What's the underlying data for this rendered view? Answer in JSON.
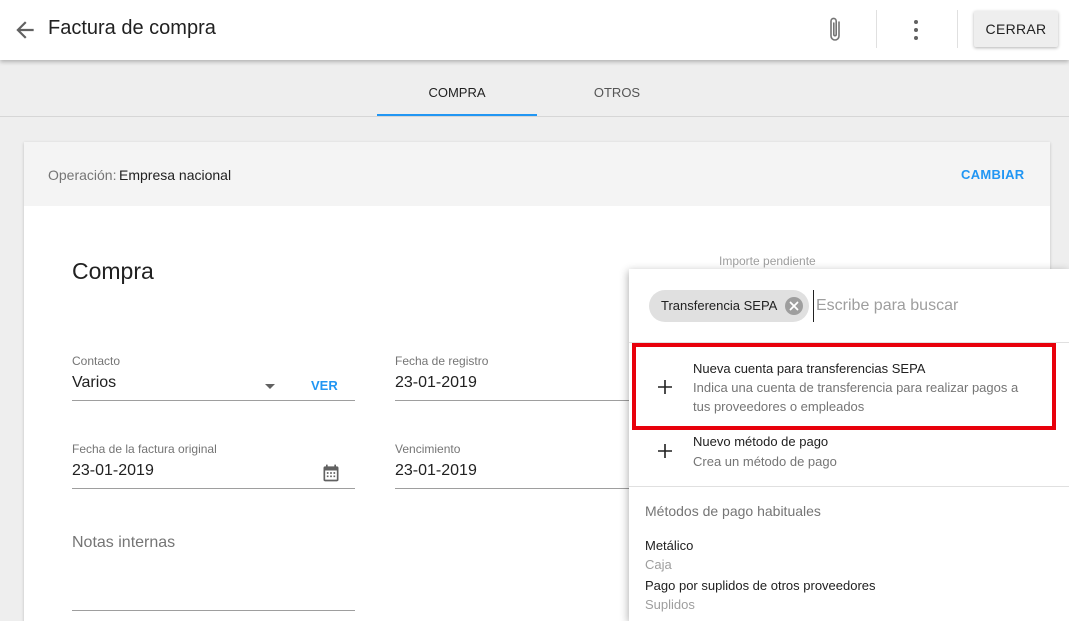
{
  "header": {
    "title": "Factura de compra",
    "close_label": "CERRAR"
  },
  "tabs": [
    {
      "label": "COMPRA",
      "active": true
    },
    {
      "label": "OTROS",
      "active": false
    }
  ],
  "operation": {
    "label": "Operación:",
    "value": "Empresa nacional",
    "change_label": "CAMBIAR"
  },
  "form": {
    "section_title": "Compra",
    "pending_label": "Importe pendiente",
    "contact": {
      "label": "Contacto",
      "value": "Varios",
      "link_label": "VER"
    },
    "registration_date": {
      "label": "Fecha de registro",
      "value": "23-01-2019"
    },
    "original_invoice_date": {
      "label": "Fecha de la factura original",
      "value": "23-01-2019"
    },
    "due_date": {
      "label": "Vencimiento",
      "value": "23-01-2019"
    },
    "internal_notes": {
      "placeholder": "Notas internas"
    }
  },
  "payment_dropdown": {
    "selected_chip": "Transferencia SEPA",
    "search_placeholder": "Escribe para buscar",
    "options": [
      {
        "title": "Nueva cuenta para transferencias SEPA",
        "description": "Indica una cuenta de transferencia para realizar pagos a tus proveedores o empleados"
      },
      {
        "title": "Nuevo método de pago",
        "description": "Crea un método de pago"
      }
    ],
    "group_title": "Métodos de pago habituales",
    "methods": [
      {
        "name": "Metálico",
        "sub": "Caja"
      },
      {
        "name": "Pago por suplidos de otros proveedores",
        "sub": "Suplidos"
      }
    ]
  },
  "colors": {
    "accent": "#2196f3",
    "highlight": "#e8000b"
  }
}
